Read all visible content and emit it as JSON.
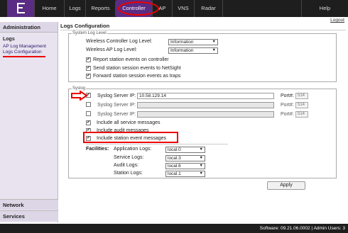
{
  "nav": {
    "items": [
      {
        "label": "Home"
      },
      {
        "label": "Logs"
      },
      {
        "label": "Reports"
      },
      {
        "label": "Controller"
      },
      {
        "label": "AP"
      },
      {
        "label": "VNS"
      },
      {
        "label": "Radar"
      }
    ],
    "active": "Controller",
    "help": "Help",
    "logout": "Logout"
  },
  "sidebar": {
    "section": "Administration",
    "group": "Logs",
    "links": [
      "AP Log Management",
      "Logs Configuration"
    ],
    "bottom": [
      "Network",
      "Services"
    ]
  },
  "main": {
    "title": "Logs Configuration",
    "system_log": {
      "legend": "System Log Level",
      "controller_label": "Wireless Controller Log Level:",
      "controller_value": "Information",
      "ap_label": "Wireless AP Log Level:",
      "ap_value": "Information",
      "checks": [
        {
          "label": "Report station events on controller",
          "checked": true
        },
        {
          "label": "Send station session events to NetSight",
          "checked": true
        },
        {
          "label": "Forward station session events as traps",
          "checked": true
        }
      ]
    },
    "syslog": {
      "legend": "Syslog",
      "server_label": "Syslog Server IP:",
      "port_label": "Port#:",
      "servers": [
        {
          "ip": "10.58.129.14",
          "port": "514",
          "checked": true
        },
        {
          "ip": "",
          "port": "514",
          "checked": false
        },
        {
          "ip": "",
          "port": "514",
          "checked": false
        }
      ],
      "checks": [
        {
          "label": "Include all service messages",
          "checked": true
        },
        {
          "label": "Include audit messages",
          "checked": true
        },
        {
          "label": "Include station event messages",
          "checked": true
        }
      ],
      "facilities_label": "Facilities:",
      "facilities": [
        {
          "label": "Application Logs:",
          "value": "local.0"
        },
        {
          "label": "Service Logs:",
          "value": "local.3"
        },
        {
          "label": "Audit Logs:",
          "value": "local.6"
        },
        {
          "label": "Station Logs:",
          "value": "local.1"
        }
      ]
    },
    "apply": "Apply"
  },
  "status": {
    "text": "Software: 09.21.06.0002 | Admin Users: 3"
  },
  "colors": {
    "brand": "#5b2c83",
    "annotation": "#e00000",
    "topbar": "#1e1e1e"
  },
  "icons": {
    "logo": "extreme-e-logo",
    "dropdown": "chevron-down-icon",
    "annotation_arrow": "red-arrow-icon"
  }
}
